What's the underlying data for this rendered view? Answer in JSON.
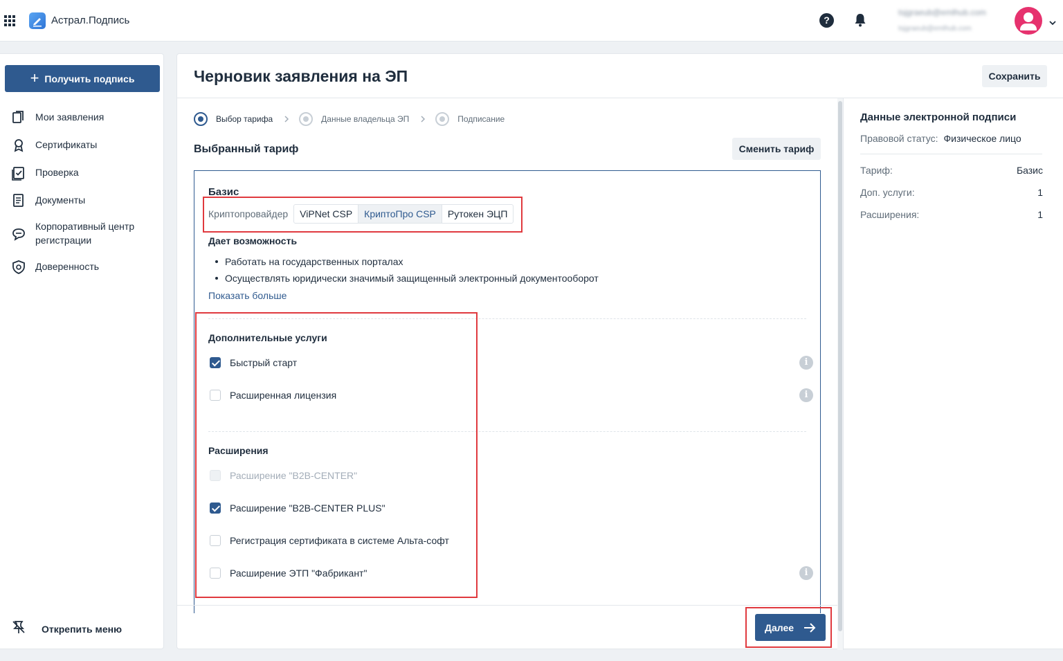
{
  "topbar": {
    "app_title": "Астрал.Подпись",
    "user_email": "tsjgraeub@emlhub.com",
    "user_email_secondary": "tsjgraeub@emlhub.com",
    "help_glyph": "?"
  },
  "sidebar": {
    "primary_button": "Получить подпись",
    "items": [
      {
        "label": "Мои заявления",
        "icon": "documents-icon"
      },
      {
        "label": "Сертификаты",
        "icon": "award-icon"
      },
      {
        "label": "Проверка",
        "icon": "checkbox-icon"
      },
      {
        "label": "Документы",
        "icon": "document-icon"
      },
      {
        "label": "Корпоративный центр регистрации",
        "icon": "chat-icon"
      },
      {
        "label": "Доверенность",
        "icon": "shield-icon"
      }
    ],
    "unpin_label": "Открепить меню"
  },
  "main": {
    "title": "Черновик заявления на ЭП",
    "save_label": "Сохранить",
    "steps": [
      {
        "label": "Выбор тарифа",
        "active": true
      },
      {
        "label": "Данные владельца ЭП",
        "active": false
      },
      {
        "label": "Подписание",
        "active": false
      }
    ],
    "section_title": "Выбранный тариф",
    "change_tariff_label": "Сменить тариф",
    "tariff": {
      "name": "Базис",
      "crypto_label": "Криптопровайдер",
      "crypto_options": [
        "ViPNet CSP",
        "КриптоПро CSP",
        "Рутокен ЭЦП"
      ],
      "crypto_selected": "КриптоПро CSP",
      "gives_title": "Дает возможность",
      "features": [
        "Работать на государственных порталах",
        "Осуществлять юридически значимый защищенный электронный документооборот"
      ],
      "show_more": "Показать больше",
      "services_title": "Дополнительные услуги",
      "services": [
        {
          "label": "Быстрый старт",
          "checked": true,
          "disabled": false,
          "info": true
        },
        {
          "label": "Расширенная лицензия",
          "checked": false,
          "disabled": false,
          "info": true
        }
      ],
      "extensions_title": "Расширения",
      "extensions": [
        {
          "label": "Расширение \"B2B-CENTER\"",
          "checked": false,
          "disabled": true,
          "info": false
        },
        {
          "label": "Расширение \"B2B-CENTER PLUS\"",
          "checked": true,
          "disabled": false,
          "info": false
        },
        {
          "label": "Регистрация сертификата в системе Альта-софт",
          "checked": false,
          "disabled": false,
          "info": false
        },
        {
          "label": "Расширение ЭТП \"Фабрикант\"",
          "checked": false,
          "disabled": false,
          "info": true
        }
      ]
    },
    "next_label": "Далее"
  },
  "info_panel": {
    "title": "Данные электронной подписи",
    "status_key": "Правовой статус:",
    "status_value": "Физическое лицо",
    "rows": [
      {
        "key": "Тариф:",
        "value": "Базис"
      },
      {
        "key": "Доп. услуги:",
        "value": "1"
      },
      {
        "key": "Расширения:",
        "value": "1"
      }
    ]
  },
  "colors": {
    "primary": "#2f5a8f",
    "annotation_red": "#e0393e",
    "avatar": "#e6326e"
  }
}
